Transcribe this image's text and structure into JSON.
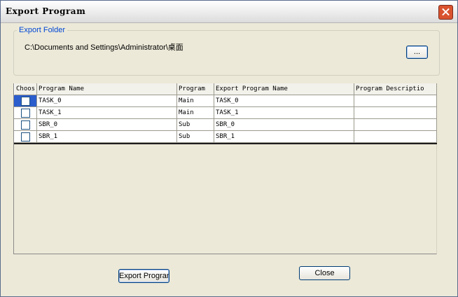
{
  "window": {
    "title": "Export Program"
  },
  "export_folder": {
    "legend": "Export Folder",
    "path": "C:\\Documents and Settings\\Administrator\\桌面",
    "browse_label": "..."
  },
  "table": {
    "columns": [
      "Choos",
      "Program Name",
      "Program",
      "Export Program Name",
      "Program Descriptio"
    ],
    "rows": [
      {
        "checked": false,
        "name": "TASK_0",
        "type": "Main",
        "export_name": "TASK_0",
        "description": ""
      },
      {
        "checked": false,
        "name": "TASK_1",
        "type": "Main",
        "export_name": "TASK_1",
        "description": ""
      },
      {
        "checked": false,
        "name": "SBR_0",
        "type": "Sub",
        "export_name": "SBR_0",
        "description": ""
      },
      {
        "checked": false,
        "name": "SBR_1",
        "type": "Sub",
        "export_name": "SBR_1",
        "description": ""
      }
    ]
  },
  "buttons": {
    "export_label": "Export Program",
    "close_label": "Close"
  },
  "colors": {
    "selection": "#2b5dcd",
    "legend": "#0046d5",
    "close": "#d9532f"
  }
}
